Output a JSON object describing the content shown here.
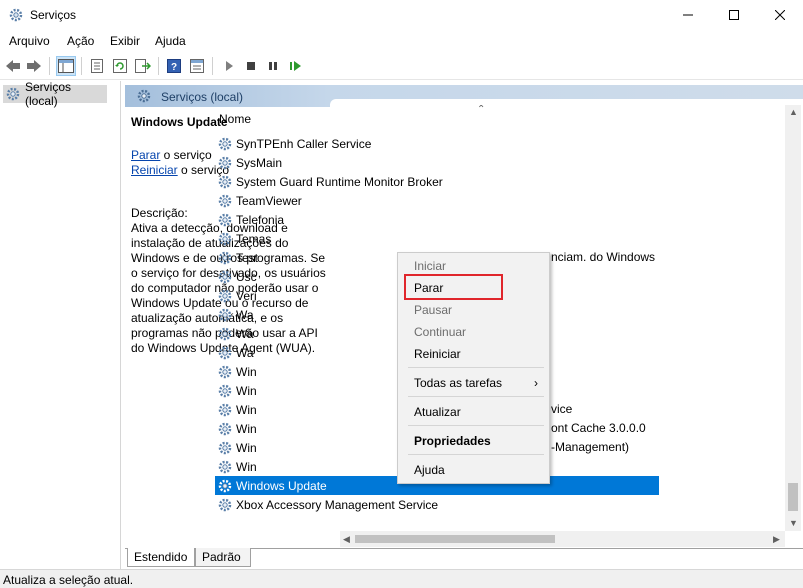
{
  "window": {
    "title": "Serviços"
  },
  "menu": [
    "Arquivo",
    "Ação",
    "Exibir",
    "Ajuda"
  ],
  "toolbar_icons": [
    "back-arrow-icon",
    "forward-arrow-icon",
    "console-tree-icon",
    "properties-icon",
    "refresh-icon",
    "export-icon",
    "help-icon",
    "view-icon",
    "play-icon",
    "stop-icon",
    "pause-icon",
    "restart-icon"
  ],
  "tree": {
    "item": "Serviços (local)"
  },
  "main": {
    "header": "Serviços (local)",
    "service_name": "Windows Update",
    "action_stop": "Parar",
    "action_stop_suffix": " o serviço",
    "action_restart": "Reiniciar",
    "action_restart_suffix": " o serviço",
    "description_label": "Descrição:",
    "description_text": "Ativa a detecção, download e instalação de atualizações do Windows e de outros programas. Se o serviço for desativado, os usuários do computador não poderão usar o Windows Update ou o recurso de atualização automática, e os programas não poderão usar a API do Windows Update Agent (WUA)."
  },
  "list": {
    "column": "Nome",
    "rows": [
      "SynTPEnh Caller Service",
      "SysMain",
      "System Guard Runtime Monitor Broker",
      "TeamViewer",
      "Telefonia",
      "Temas",
      "Test",
      "Usc",
      "Veri",
      "Wa",
      "Wa",
      "Wa",
      "Win",
      "Win",
      "Win",
      "Win",
      "Win",
      "Win",
      "Windows Update",
      "Xbox Accessory Management Service"
    ],
    "row_tails": {
      "6": "nciam. do Windows",
      "14": "vice",
      "15": "ont Cache 3.0.0.0",
      "16": "-Management)"
    },
    "selected": "Windows Update"
  },
  "context_menu": {
    "items": [
      {
        "label": "Iniciar",
        "disabled": true
      },
      {
        "label": "Parar",
        "disabled": false
      },
      {
        "label": "Pausar",
        "disabled": true
      },
      {
        "label": "Continuar",
        "disabled": true
      },
      {
        "label": "Reiniciar",
        "disabled": false
      },
      {
        "label": "Todas as tarefas",
        "disabled": false,
        "submenu": true
      },
      {
        "label": "Atualizar",
        "disabled": false
      },
      {
        "label": "Propriedades",
        "disabled": false,
        "bold": true
      },
      {
        "label": "Ajuda",
        "disabled": false
      }
    ],
    "highlighted": "Parar",
    "highlight_color": "#e0262c"
  },
  "tabs": [
    "Estendido",
    "Padrão"
  ],
  "status": "Atualiza a seleção atual.",
  "colors": {
    "selection": "#0078d7",
    "link": "#0645ad"
  }
}
